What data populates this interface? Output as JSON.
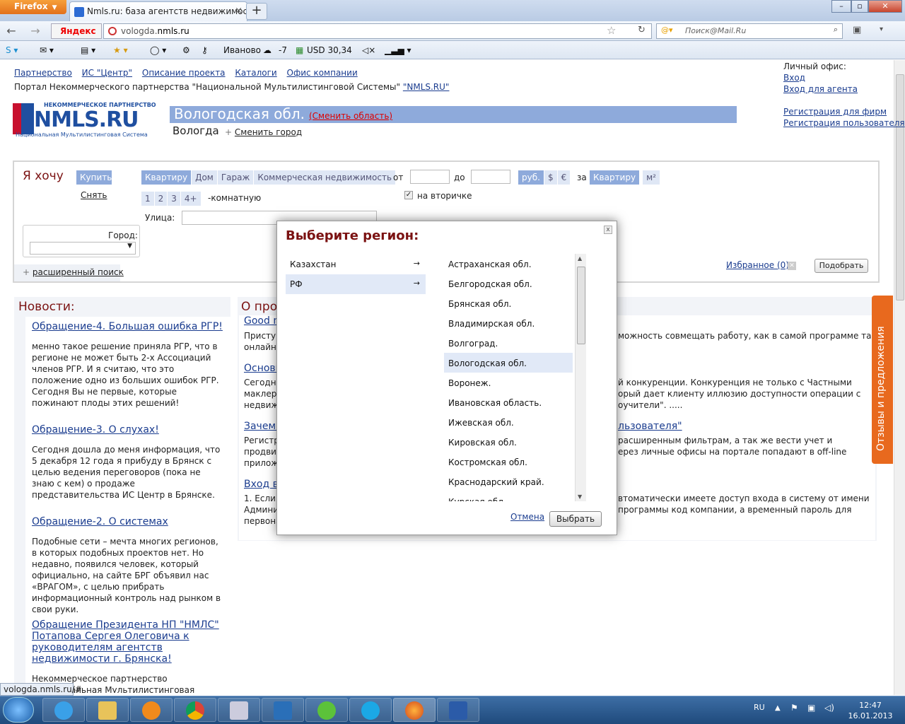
{
  "browser": {
    "app_button": "Firefox",
    "tab_title": "Nmls.ru: база агентств недвижимости. ...",
    "new_tab": "+",
    "yandex": "Яндекс",
    "url_host": "vologda.",
    "url_rest": "nmls.ru",
    "search_placeholder": "Поиск@Mail.Ru",
    "toolbar": {
      "city": "Иваново",
      "temp": "-7",
      "currency": "USD 30,34"
    }
  },
  "site": {
    "top_links": [
      "Партнерство",
      "ИС \"Центр\"",
      "Описание проекта",
      "Каталоги",
      "Офис компании"
    ],
    "portal_text": "Портал Некоммерческого партнерства \"Национальной Мультилистинговой Системы\" ",
    "portal_link": "\"NMLS.RU\"",
    "logo_top": "НЕКОММЕРЧЕСКОЕ ПАРТНЕРСТВО",
    "logo_main": "NMLS.RU",
    "logo_bottom": "Национальная Мультилистинговая Система",
    "office": {
      "title": "Личный офис:",
      "login": "Вход",
      "agent_login": "Вход для агента",
      "reg_firms": "Регистрация для фирм",
      "reg_user": "Регистрация пользователя"
    },
    "region": "Вологодская обл.",
    "change_region": "(Сменить область)",
    "city": "Вологда",
    "change_city": "Сменить город"
  },
  "search": {
    "want": "Я хочу",
    "buy": "Купить",
    "rent": "Снять",
    "types": [
      "Квартиру",
      "Дом",
      "Гараж",
      "Коммерческая недвижимость"
    ],
    "rooms": [
      "1",
      "2",
      "3",
      "4+"
    ],
    "rooms_suffix": "-комнатную",
    "from": "от",
    "to": "до",
    "currencies": [
      "руб.",
      "$",
      "€"
    ],
    "per": "за",
    "per_unit": [
      "Квартиру",
      "м²"
    ],
    "secondary": "на вторичке",
    "street": "Улица:",
    "city_label": "Город:",
    "advanced": "расширенный поиск",
    "favorites": "Избранное (0)",
    "submit": "Подобрать"
  },
  "news": {
    "title": "Новости:",
    "items": [
      {
        "title": "Обращение-4. Большая ошибка РГР!",
        "text": "менно такое решение приняла РГР, что в регионе не может быть 2-х Ассоциаций членов РГР. И я считаю, что это положение одно из больших ошибок РГР. Сегодня Вы не первые, которые пожинают плоды этих решений!"
      },
      {
        "title": "Обращение-3. О слухах!",
        "text": "Сегодня дошла до меня информация, что 5 декабря 12 года я прибуду в Брянск с целью ведения переговоров (пока не знаю с кем) о продаже представительства ИС Центр в Брянске."
      },
      {
        "title": "Обращение-2. О системах",
        "text": "Подобные сети – мечта многих регионов, в которых подобных проектов нет. Но недавно, появился человек, который официально, на сайте БРГ объявил нас «ВРАГОМ», с целью прибрать информационный контроль над рынком в свои руки."
      },
      {
        "title": "Обращение Президента НП \"НМЛС\" Потапова Сергея Олеговича к руководителям агентств недвижимости г. Брянска!",
        "text": "Некоммерческое партнерство «Национальная Мультилистинговая Система» создано с целью"
      }
    ]
  },
  "about": {
    "title": "О про",
    "links": [
      "Good n",
      "Основн",
      "Зачем н",
      "Вход в"
    ],
    "left_frag": [
      "Приступ",
      "онлайн",
      "Сегодня",
      "маклера",
      "недвиж",
      "Регистр",
      "продвиж",
      "приложе",
      "1. Если",
      "Админис",
      "первона"
    ],
    "right_frag": [
      "можность совмещать работу, как в самой программе так и с",
      "й конкуренции. Конкуренция не только с Частными",
      "орый дает клиенту иллюзию доступности операции с",
      "оучители\". .....",
      "льзователя\"",
      "расширенным фильтрам, а так же вести учет и",
      "ерез личные офисы на портале попадают в off-line",
      "втоматически имеете доступ входа в систему от имени",
      "программы код компании, а временный пароль для"
    ]
  },
  "feedback": "Отзывы и предложения",
  "status_url": "vologda.nmls.ru/#",
  "dialog": {
    "title": "Выберите регион:",
    "close": "x",
    "countries": [
      {
        "name": "Казахстан",
        "selected": false
      },
      {
        "name": "РФ",
        "selected": true
      }
    ],
    "regions": [
      {
        "name": "Астраханская обл.",
        "selected": false
      },
      {
        "name": "Белгородская обл.",
        "selected": false
      },
      {
        "name": "Брянская обл.",
        "selected": false
      },
      {
        "name": "Владимирская обл.",
        "selected": false
      },
      {
        "name": "Волгоград.",
        "selected": false
      },
      {
        "name": "Вологодская обл.",
        "selected": true
      },
      {
        "name": "Воронеж.",
        "selected": false
      },
      {
        "name": "Ивановская область.",
        "selected": false
      },
      {
        "name": "Ижевская обл.",
        "selected": false
      },
      {
        "name": "Кировская обл.",
        "selected": false
      },
      {
        "name": "Костромская обл.",
        "selected": false
      },
      {
        "name": "Краснодарский край.",
        "selected": false
      },
      {
        "name": "Курская обл.",
        "selected": false
      }
    ],
    "cancel": "Отмена",
    "choose": "Выбрать"
  },
  "taskbar": {
    "lang": "RU",
    "time": "12:47",
    "date": "16.01.2013"
  }
}
